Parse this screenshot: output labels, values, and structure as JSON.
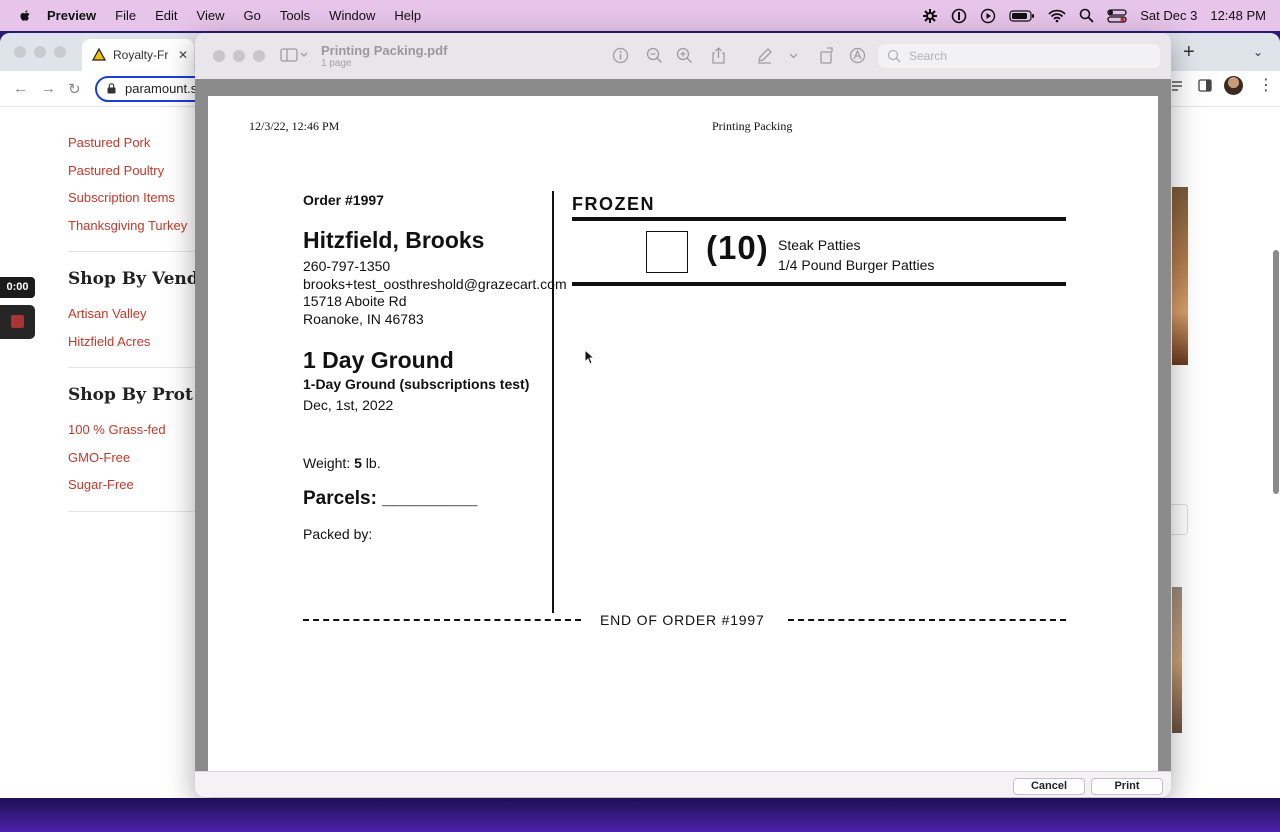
{
  "menubar": {
    "app_name": "Preview",
    "items": [
      "File",
      "Edit",
      "View",
      "Go",
      "Tools",
      "Window",
      "Help"
    ],
    "date": "Sat Dec 3",
    "time": "12:48 PM"
  },
  "browser": {
    "tab_title": "Royalty-Fr",
    "url": "paramount.s",
    "sidebar": {
      "links_top": [
        "Pastured Pork",
        "Pastured Poultry",
        "Subscription Items",
        "Thanksgiving Turkey"
      ],
      "heading_vendor": "Shop By Vend",
      "links_vendor": [
        "Artisan Valley",
        "Hitzfield Acres"
      ],
      "heading_protocol": "Shop By Prot",
      "links_protocol": [
        "100 % Grass-fed",
        "GMO-Free",
        "Sugar-Free"
      ]
    }
  },
  "recorder": {
    "time": "0:00"
  },
  "preview": {
    "title": "Printing Packing.pdf",
    "subtitle": "1 page",
    "search_placeholder": "Search",
    "cancel_label": "Cancel",
    "print_label": "Print"
  },
  "document": {
    "header_datetime": "12/3/22, 12:46 PM",
    "header_title": "Printing Packing",
    "order_number": "Order #1997",
    "customer_name": "Hitzfield, Brooks",
    "phone": "260-797-1350",
    "email": "brooks+test_oosthreshold@grazecart.com",
    "address_line1": "15718 Aboite Rd",
    "address_line2": "Roanoke, IN 46783",
    "schedule_title": "1 Day Ground",
    "schedule_subtitle": "1-Day Ground (subscriptions test)",
    "schedule_date": "Dec, 1st, 2022",
    "weight_label": "Weight: ",
    "weight_value": "5",
    "weight_unit": " lb.",
    "parcels_label": "Parcels: _________",
    "packed_by_label": "Packed by:",
    "section_title": "FROZEN",
    "item_qty": "(10)",
    "item_name": "Steak Patties",
    "item_variant": "1/4 Pound Burger Patties",
    "end_text": "END OF ORDER #1997"
  }
}
